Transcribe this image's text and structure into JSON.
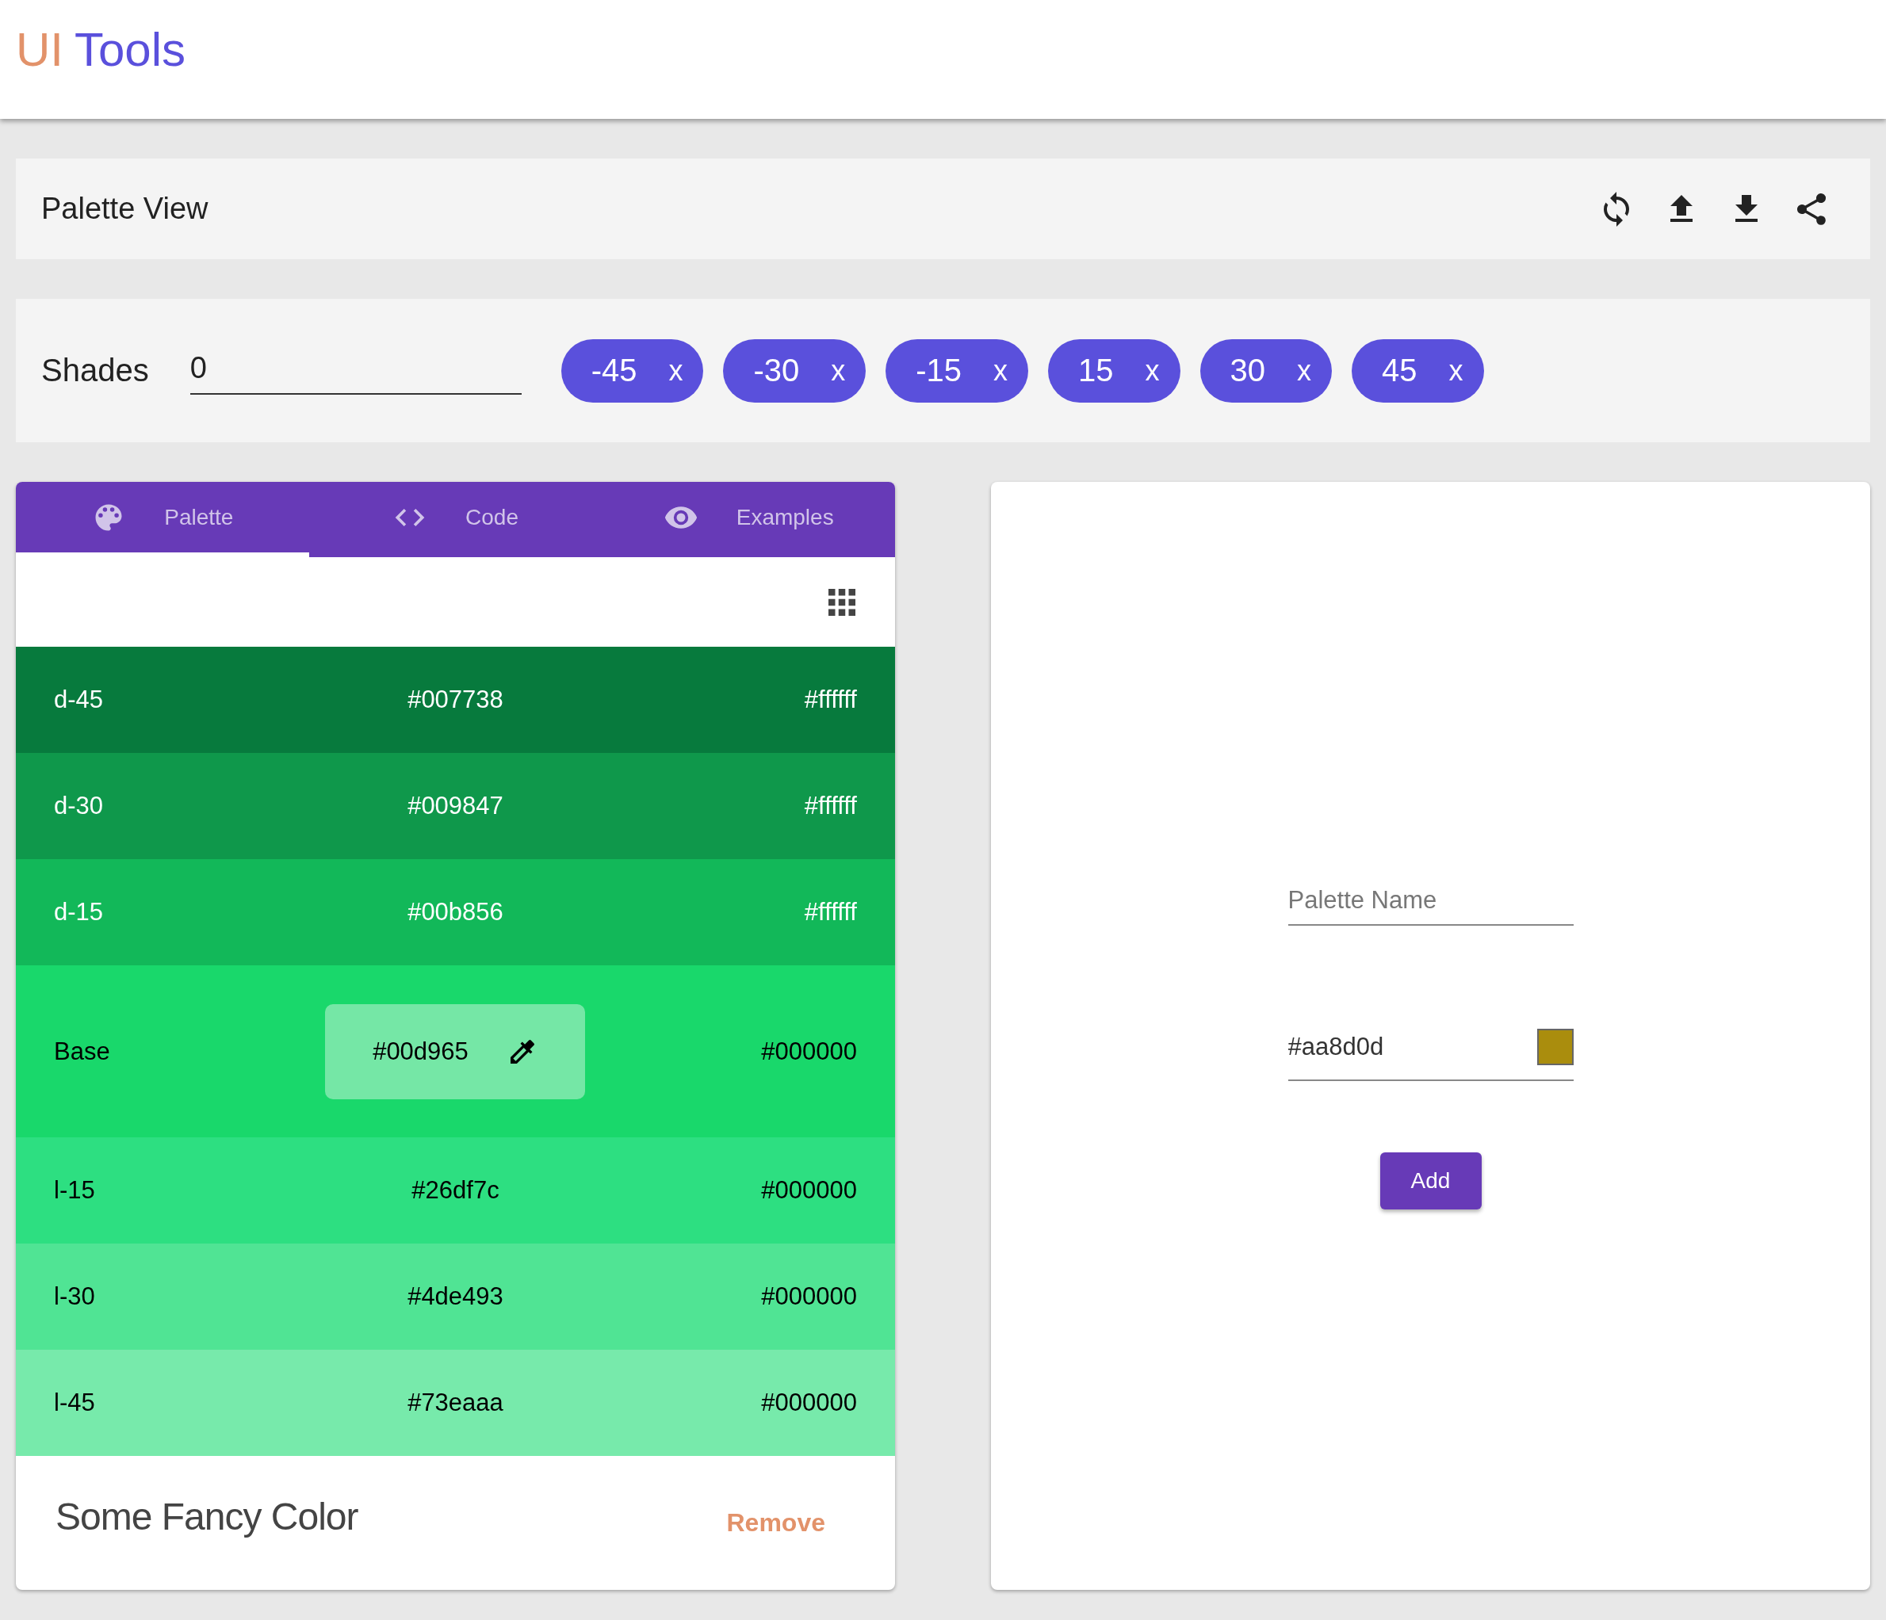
{
  "app_title": {
    "part_1": "UI",
    "part_2": "Tools"
  },
  "toolbar": {
    "title": "Palette View"
  },
  "shades": {
    "label": "Shades",
    "value": "0",
    "chips": [
      {
        "label": "-45",
        "remove": "x"
      },
      {
        "label": "-30",
        "remove": "x"
      },
      {
        "label": "-15",
        "remove": "x"
      },
      {
        "label": "15",
        "remove": "x"
      },
      {
        "label": "30",
        "remove": "x"
      },
      {
        "label": "45",
        "remove": "x"
      }
    ]
  },
  "tabs": [
    {
      "label": "Palette",
      "selected": true
    },
    {
      "label": "Code",
      "selected": false
    },
    {
      "label": "Examples",
      "selected": false
    }
  ],
  "rows": [
    {
      "kind": "dark",
      "name": "d-45",
      "hex": "#007738",
      "contrast": "#ffffff",
      "color": "#077a3d"
    },
    {
      "kind": "dark",
      "name": "d-30",
      "hex": "#009847",
      "contrast": "#ffffff",
      "color": "#0f984b"
    },
    {
      "kind": "dark",
      "name": "d-15",
      "hex": "#00b856",
      "contrast": "#ffffff",
      "color": "#12b859"
    },
    {
      "kind": "base",
      "name": "Base",
      "hex": "#00d965",
      "contrast": "#000000",
      "color": "#19d86b"
    },
    {
      "kind": "light",
      "name": "l-15",
      "hex": "#26df7c",
      "contrast": "#000000",
      "color": "#2ddf81"
    },
    {
      "kind": "light",
      "name": "l-30",
      "hex": "#4de493",
      "contrast": "#000000",
      "color": "#50e494"
    },
    {
      "kind": "light",
      "name": "l-45",
      "hex": "#73eaaa",
      "contrast": "#000000",
      "color": "#77eaab"
    }
  ],
  "card_footer": {
    "title": "Some Fancy Color",
    "action": "Remove"
  },
  "form": {
    "name_placeholder": "Palette Name",
    "color_value": "#aa8d0d",
    "swatch": {
      "color": "#aa8d0d"
    },
    "button": "Add"
  }
}
